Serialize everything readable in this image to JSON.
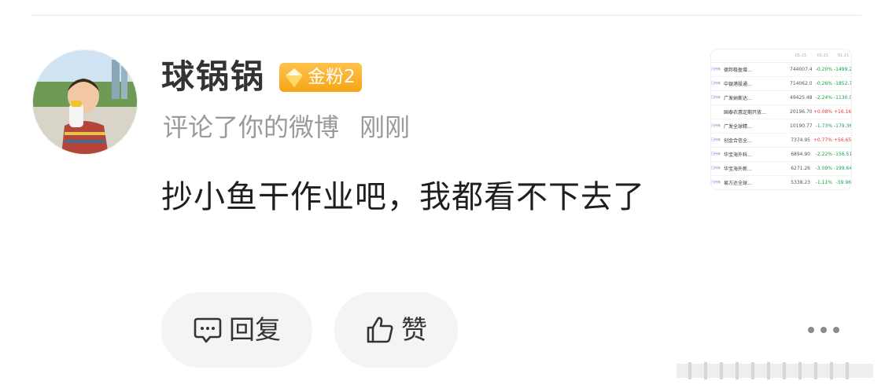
{
  "comment_card": {
    "username": "球锅锅",
    "badge": {
      "label": "金粉2",
      "icon": "gem-icon",
      "color": "#f5a515"
    },
    "action_text": "评论了你的微博",
    "time": "刚刚",
    "content": "抄小鱼干作业吧，我都看不下去了",
    "reply_label": "回复",
    "like_label": "赞",
    "more_icon": "more-icon"
  },
  "thumbnail": {
    "headers": [
      "",
      "",
      "",
      "01-21",
      "01-21",
      "01-21"
    ],
    "rows": [
      {
        "tag": "已持有",
        "name": "德邦稳盈增…",
        "value": "744007.47",
        "pct": "-0.20%",
        "amount": "-1499.29",
        "dir": "neg"
      },
      {
        "tag": "已持有",
        "name": "中银港股通…",
        "value": "714062.04",
        "pct": "-0.26%",
        "amount": "-1852.78",
        "dir": "neg"
      },
      {
        "tag": "已持有",
        "name": "广发纳斯达…",
        "value": "49425.48",
        "pct": "-2.24%",
        "amount": "-1130.06",
        "dir": "neg"
      },
      {
        "tag": "",
        "name": "国泰农惠定期开放…",
        "value": "20196.70",
        "pct": "+0.08%",
        "amount": "+16.16",
        "dir": "pos"
      },
      {
        "tag": "已持有",
        "name": "广发全球精…",
        "value": "10190.77",
        "pct": "-1.73%",
        "amount": "-179.36",
        "dir": "neg"
      },
      {
        "tag": "已持有",
        "name": "创金合信全…",
        "value": "7374.95",
        "pct": "+0.77%",
        "amount": "+56.65",
        "dir": "pos"
      },
      {
        "tag": "已持有",
        "name": "华宝海外科…",
        "value": "6894.90",
        "pct": "-2.22%",
        "amount": "-156.51",
        "dir": "neg"
      },
      {
        "tag": "已持有",
        "name": "华宝海外新…",
        "value": "6271.26",
        "pct": "-3.09%",
        "amount": "-199.64",
        "dir": "neg"
      },
      {
        "tag": "已持有",
        "name": "易方达全球…",
        "value": "5338.23",
        "pct": "-1.11%",
        "amount": "-59.96",
        "dir": "neg"
      }
    ]
  }
}
